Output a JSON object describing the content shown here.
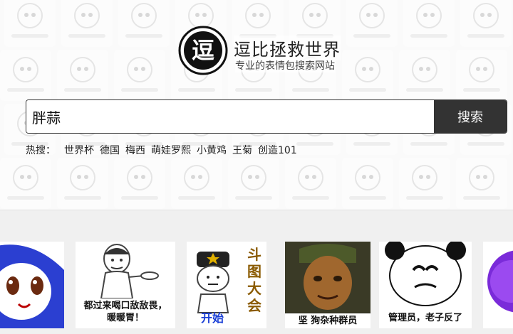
{
  "site": {
    "title": "逗比拯救世界",
    "subtitle": "专业的表情包搜索网站",
    "logo_glyph": "逗"
  },
  "search": {
    "value": "胖蒜",
    "button_label": "搜索"
  },
  "hot": {
    "label": "热搜：",
    "items": [
      "世界杯",
      "德国",
      "梅西",
      "萌娃罗熙",
      "小黄鸡",
      "王菊",
      "创造101"
    ]
  },
  "stickers": [
    {
      "caption": ""
    },
    {
      "caption": "都过来喝口敌敌畏，\n暖暖胃！"
    },
    {
      "caption": "开始",
      "side_text": "斗图大会"
    },
    {
      "caption": "坚  狗杂种群员"
    },
    {
      "caption": "管理员，老子反了"
    },
    {
      "caption": ""
    }
  ],
  "colors": {
    "button_bg": "#333333",
    "button_text": "#ffffff",
    "page_bg": "#f0f0f0"
  }
}
